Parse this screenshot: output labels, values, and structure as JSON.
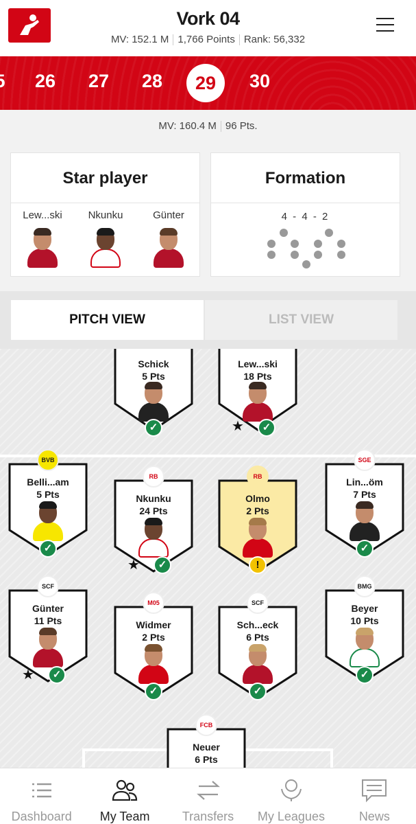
{
  "header": {
    "title": "Vork 04",
    "market_value": "MV: 152.1 M",
    "points": "1,766 Points",
    "rank": "Rank: 56,332"
  },
  "matchdays": [
    "5",
    "26",
    "27",
    "28",
    "29",
    "30"
  ],
  "active_matchday": "29",
  "summary": {
    "mv": "MV: 160.4 M",
    "pts": "96 Pts."
  },
  "star_player": {
    "title": "Star player",
    "players": [
      "Lew...ski",
      "Nkunku",
      "Günter"
    ]
  },
  "formation": {
    "title": "Formation",
    "value": "4 - 4 - 2"
  },
  "tabs": {
    "pitch": "PITCH VIEW",
    "list": "LIST VIEW"
  },
  "pitch": {
    "forwards": [
      {
        "name": "Schick",
        "pts": "5 Pts",
        "star": false,
        "status": "ok"
      },
      {
        "name": "Lew...ski",
        "pts": "18 Pts",
        "star": true,
        "status": "ok"
      }
    ],
    "midfield": [
      {
        "name": "Belli...am",
        "pts": "5 Pts",
        "club": "BVB",
        "status": "ok"
      },
      {
        "name": "Nkunku",
        "pts": "24 Pts",
        "club": "RB",
        "star": true,
        "status": "ok"
      },
      {
        "name": "Olmo",
        "pts": "2 Pts",
        "club": "RB",
        "status": "warn"
      },
      {
        "name": "Lin...öm",
        "pts": "7 Pts",
        "club": "SGE",
        "status": "ok"
      }
    ],
    "defense": [
      {
        "name": "Günter",
        "pts": "11 Pts",
        "club": "SCF",
        "star": true,
        "status": "ok"
      },
      {
        "name": "Widmer",
        "pts": "2 Pts",
        "club": "M05",
        "status": "ok"
      },
      {
        "name": "Sch...eck",
        "pts": "6 Pts",
        "club": "SCF",
        "status": "ok"
      },
      {
        "name": "Beyer",
        "pts": "10 Pts",
        "club": "BMG",
        "status": "ok"
      }
    ],
    "goalkeeper": {
      "name": "Neuer",
      "pts": "6 Pts",
      "club": "FCB"
    }
  },
  "nav": [
    {
      "label": "Dashboard",
      "icon": "list-icon"
    },
    {
      "label": "My Team",
      "icon": "team-icon"
    },
    {
      "label": "Transfers",
      "icon": "transfer-arrows-icon"
    },
    {
      "label": "My Leagues",
      "icon": "trophy-icon"
    },
    {
      "label": "News",
      "icon": "news-icon"
    }
  ],
  "colors": {
    "brand": "#d20515",
    "ok": "#1a8a4a",
    "warn": "#f2c200"
  }
}
